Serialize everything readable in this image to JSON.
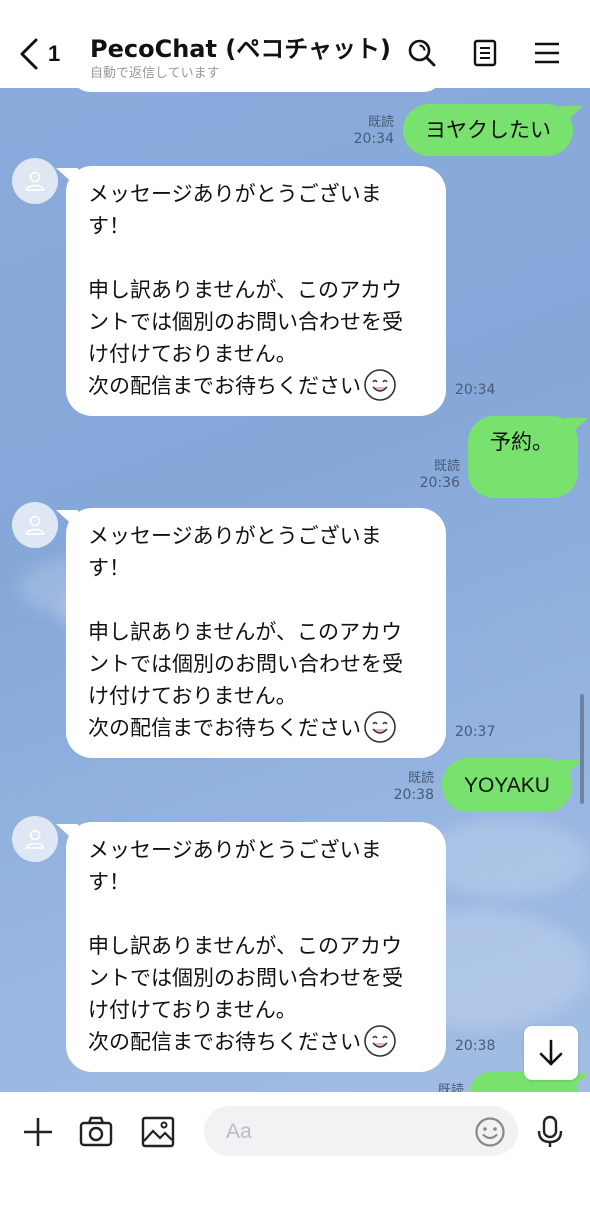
{
  "header": {
    "unread_count": "1",
    "title": "PecoChat (ペコチャット)",
    "subtitle": "自動で返信しています",
    "icons": [
      "chevron-left-icon",
      "search-icon",
      "note-icon",
      "menu-icon"
    ]
  },
  "messages": {
    "out1": {
      "text": "ヨヤクしたい",
      "read": "既読",
      "time": "20:34"
    },
    "in1": {
      "lines": [
        "メッセージありがとうございま",
        "す！",
        "",
        "申し訳ありませんが、このアカウ",
        "ントでは個別のお問い合わせを受",
        "け付けておりません。",
        "次の配信までお待ちください"
      ],
      "time": "20:34"
    },
    "out2": {
      "text": "予約。",
      "read": "既読",
      "time": "20:36"
    },
    "in2": {
      "lines": [
        "メッセージありがとうございま",
        "す！",
        "",
        "申し訳ありませんが、このアカウ",
        "ントでは個別のお問い合わせを受",
        "け付けておりません。",
        "次の配信までお待ちください"
      ],
      "time": "20:37"
    },
    "out3": {
      "text": "YOYAKU",
      "read": "既読",
      "time": "20:38"
    },
    "in3": {
      "lines": [
        "メッセージありがとうございま",
        "す！",
        "",
        "申し訳ありませんが、このアカウ",
        "ントでは個別のお問い合わせを受",
        "け付けておりません。",
        "次の配信までお待ちください"
      ],
      "time": "20:38"
    },
    "out4_partial": {
      "read": "既読"
    }
  },
  "composer": {
    "placeholder": "Aa",
    "icons": [
      "plus-icon",
      "camera-icon",
      "image-icon",
      "smiley-icon",
      "microphone-icon"
    ]
  },
  "colors": {
    "chat_background": "#8aabdc",
    "outgoing_bubble": "#79e26f",
    "incoming_bubble": "#ffffff"
  }
}
